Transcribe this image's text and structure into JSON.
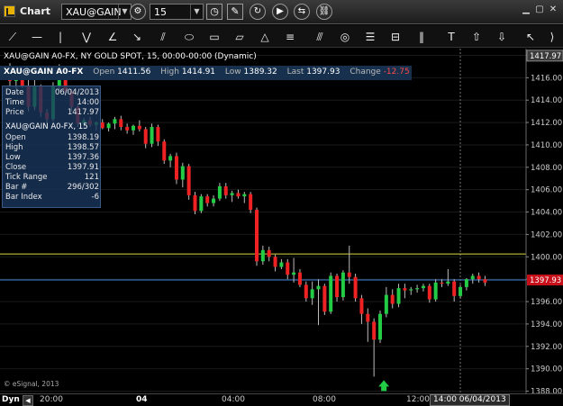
{
  "window": {
    "title": "Chart",
    "symbol_value": "XAU@GAIN",
    "interval_value": "15"
  },
  "symbol_info": {
    "description": "XAU@GAIN A0-FX, NY GOLD SPOT, 15, 00:00-00:00 (Dynamic)",
    "symbol": "XAU@GAIN A0-FX",
    "open_label": "Open",
    "open": "1411.56",
    "high_label": "High",
    "high": "1414.91",
    "low_label": "Low",
    "low": "1389.32",
    "last_label": "Last",
    "last": "1397.93",
    "change_label": "Change",
    "change": "-12.75"
  },
  "data_window": {
    "date_label": "Date",
    "date": "06/04/2013",
    "time_label": "Time",
    "time": "14:00",
    "price_label": "Price",
    "price": "1417.97",
    "header": "XAU@GAIN A0-FX, 15",
    "open_label": "Open",
    "open": "1398.19",
    "high_label": "High",
    "high": "1398.57",
    "low_label": "Low",
    "low": "1397.36",
    "close_label": "Close",
    "close": "1397.91",
    "tick_range_label": "Tick Range",
    "tick_range": "121",
    "bar_label": "Bar #",
    "bar": "296/302",
    "bar_index_label": "Bar Index",
    "bar_index": "-6"
  },
  "watermark": "© eSignal, 2013",
  "time_axis": {
    "dyn_label": "Dyn",
    "labels": [
      "20:00",
      "04",
      "04:00",
      "08:00",
      "12:00"
    ],
    "cursor_time": "14:00 06/04/2013"
  },
  "price_axis": {
    "cursor_price": "1417.97",
    "last_price": "1397.93"
  },
  "colors": {
    "up": "#22cc44",
    "down": "#ee2222",
    "yellow_line": "#d8d840",
    "blue_line": "#3f7fd8",
    "info_bg": "#16304d",
    "arrow": "#22cc44"
  },
  "chart_data": {
    "type": "candlestick",
    "y_ticks": [
      "1418.00",
      "1416.00",
      "1414.00",
      "1412.00",
      "1410.00",
      "1408.00",
      "1406.00",
      "1404.00",
      "1402.00",
      "1400.00",
      "1398.00",
      "1396.00",
      "1394.00",
      "1392.00",
      "1390.00",
      "1388.00"
    ],
    "ylim": [
      1387.8,
      1418.6
    ],
    "horizontal_lines": [
      1400.25,
      1397.93
    ],
    "candles": [
      [
        1416.9,
        1417.3,
        1415.3,
        1415.7
      ],
      [
        1415.7,
        1416.3,
        1415.0,
        1416.0
      ],
      [
        1416.0,
        1416.9,
        1415.1,
        1415.3
      ],
      [
        1415.3,
        1415.9,
        1413.0,
        1413.4
      ],
      [
        1413.4,
        1415.8,
        1413.1,
        1415.2
      ],
      [
        1415.2,
        1415.4,
        1412.5,
        1412.9
      ],
      [
        1412.9,
        1413.2,
        1412.0,
        1412.3
      ],
      [
        1412.3,
        1415.6,
        1412.1,
        1415.3
      ],
      [
        1415.3,
        1417.2,
        1414.8,
        1416.8
      ],
      [
        1416.8,
        1417.0,
        1414.4,
        1414.8
      ],
      [
        1414.8,
        1415.0,
        1413.0,
        1413.4
      ],
      [
        1413.4,
        1413.6,
        1411.6,
        1411.9
      ],
      [
        1411.9,
        1412.4,
        1411.5,
        1412.2
      ],
      [
        1412.2,
        1412.5,
        1411.6,
        1411.8
      ],
      [
        1411.8,
        1412.1,
        1411.3,
        1412.0
      ],
      [
        1412.0,
        1412.3,
        1411.4,
        1411.5
      ],
      [
        1411.5,
        1412.0,
        1411.2,
        1411.9
      ],
      [
        1411.9,
        1412.5,
        1411.4,
        1412.3
      ],
      [
        1412.3,
        1412.6,
        1411.3,
        1411.6
      ],
      [
        1411.6,
        1411.9,
        1411.0,
        1411.3
      ],
      [
        1411.3,
        1411.8,
        1410.9,
        1411.7
      ],
      [
        1411.7,
        1412.2,
        1411.2,
        1411.4
      ],
      [
        1411.4,
        1411.6,
        1409.7,
        1410.1
      ],
      [
        1410.1,
        1411.9,
        1409.8,
        1411.6
      ],
      [
        1411.6,
        1411.8,
        1409.9,
        1410.3
      ],
      [
        1410.3,
        1410.5,
        1408.3,
        1408.6
      ],
      [
        1408.6,
        1409.2,
        1408.0,
        1409.0
      ],
      [
        1409.0,
        1409.3,
        1406.5,
        1406.9
      ],
      [
        1406.9,
        1408.4,
        1406.2,
        1408.1
      ],
      [
        1408.1,
        1408.3,
        1405.1,
        1405.5
      ],
      [
        1405.5,
        1405.8,
        1403.8,
        1404.1
      ],
      [
        1404.1,
        1405.6,
        1403.9,
        1405.4
      ],
      [
        1405.4,
        1405.6,
        1404.5,
        1404.8
      ],
      [
        1404.8,
        1405.5,
        1404.5,
        1405.2
      ],
      [
        1405.2,
        1406.6,
        1405.0,
        1406.3
      ],
      [
        1406.3,
        1406.6,
        1405.2,
        1405.5
      ],
      [
        1405.5,
        1405.9,
        1404.9,
        1405.7
      ],
      [
        1405.7,
        1406.0,
        1405.2,
        1405.4
      ],
      [
        1405.4,
        1405.8,
        1404.8,
        1405.6
      ],
      [
        1405.6,
        1405.8,
        1403.9,
        1404.2
      ],
      [
        1404.2,
        1404.4,
        1399.2,
        1399.6
      ],
      [
        1399.6,
        1401.0,
        1399.3,
        1400.6
      ],
      [
        1400.6,
        1400.9,
        1399.6,
        1400.0
      ],
      [
        1400.0,
        1400.2,
        1398.7,
        1399.1
      ],
      [
        1399.1,
        1399.8,
        1398.9,
        1399.5
      ],
      [
        1399.5,
        1399.8,
        1398.0,
        1398.4
      ],
      [
        1398.4,
        1399.9,
        1397.7,
        1398.6
      ],
      [
        1398.6,
        1398.9,
        1397.3,
        1397.5
      ],
      [
        1397.5,
        1397.8,
        1396.0,
        1396.3
      ],
      [
        1396.3,
        1397.8,
        1395.7,
        1397.1
      ],
      [
        1397.1,
        1398.0,
        1393.9,
        1397.4
      ],
      [
        1397.4,
        1397.6,
        1394.8,
        1395.1
      ],
      [
        1395.1,
        1398.6,
        1394.9,
        1398.3
      ],
      [
        1398.3,
        1398.5,
        1396.0,
        1396.4
      ],
      [
        1396.4,
        1398.8,
        1396.1,
        1398.6
      ],
      [
        1398.6,
        1401.0,
        1397.6,
        1398.2
      ],
      [
        1398.2,
        1398.5,
        1396.0,
        1396.3
      ],
      [
        1396.3,
        1396.6,
        1394.0,
        1394.9
      ],
      [
        1394.9,
        1395.4,
        1392.4,
        1394.2
      ],
      [
        1394.2,
        1394.5,
        1389.3,
        1392.6
      ],
      [
        1392.6,
        1395.2,
        1392.3,
        1394.9
      ],
      [
        1394.9,
        1397.3,
        1394.6,
        1396.6
      ],
      [
        1396.6,
        1397.1,
        1395.4,
        1395.8
      ],
      [
        1395.8,
        1397.6,
        1395.5,
        1397.2
      ],
      [
        1397.2,
        1397.6,
        1396.3,
        1397.0
      ],
      [
        1397.0,
        1397.3,
        1396.6,
        1397.1
      ],
      [
        1397.1,
        1397.5,
        1396.8,
        1397.2
      ],
      [
        1397.2,
        1397.6,
        1396.9,
        1397.4
      ],
      [
        1397.4,
        1397.6,
        1395.9,
        1396.2
      ],
      [
        1396.2,
        1398.0,
        1396.0,
        1397.7
      ],
      [
        1397.7,
        1398.0,
        1397.3,
        1397.6
      ],
      [
        1397.6,
        1398.9,
        1397.4,
        1397.8
      ],
      [
        1397.8,
        1398.0,
        1396.0,
        1396.5
      ],
      [
        1396.5,
        1397.5,
        1396.3,
        1397.3
      ],
      [
        1397.3,
        1398.1,
        1397.0,
        1398.0
      ],
      [
        1398.0,
        1398.5,
        1397.6,
        1398.3
      ],
      [
        1398.3,
        1398.6,
        1397.7,
        1398.0
      ],
      [
        1398.0,
        1398.3,
        1397.4,
        1397.7
      ]
    ]
  }
}
